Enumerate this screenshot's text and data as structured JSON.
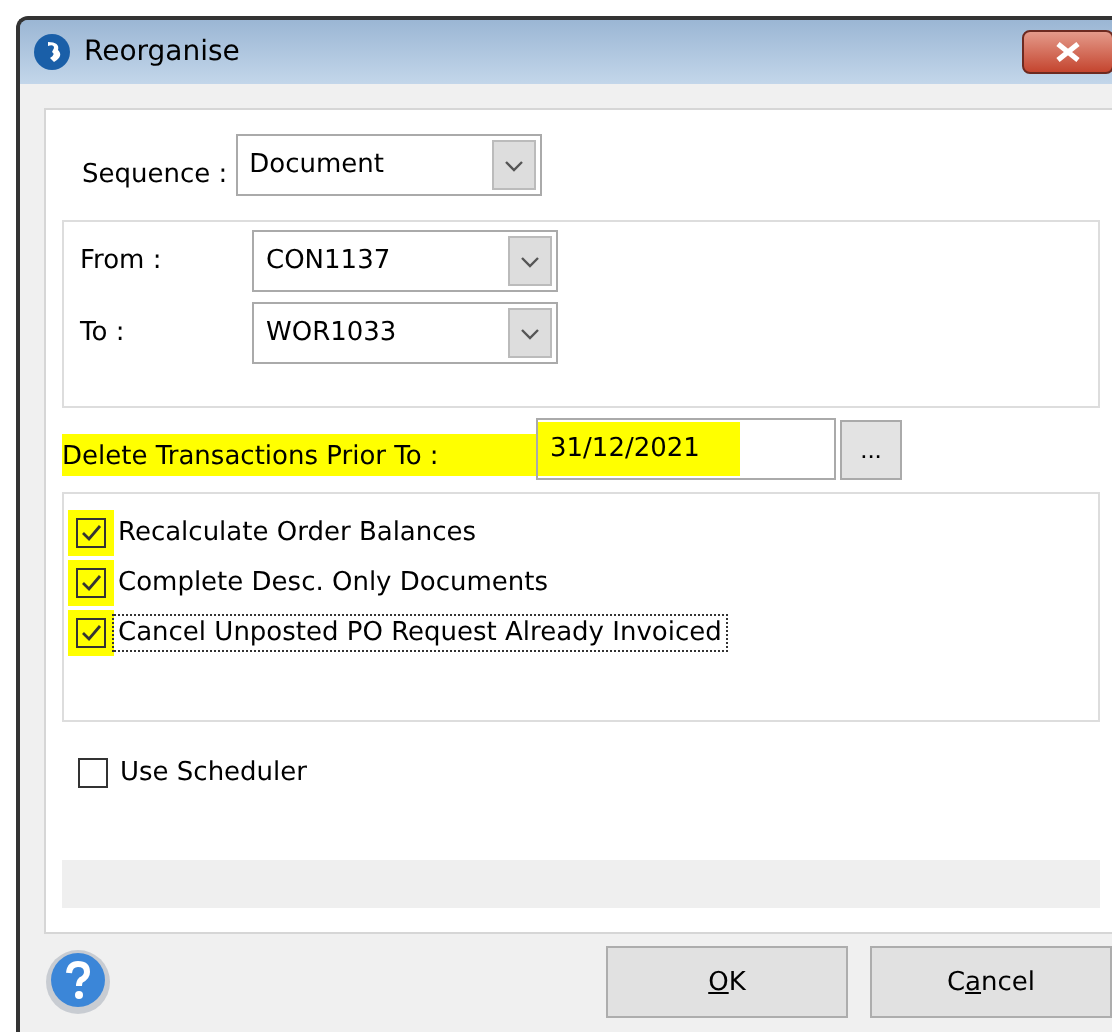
{
  "window": {
    "title": "Reorganise"
  },
  "sequence": {
    "label": "Sequence :",
    "value": "Document"
  },
  "range": [
    {
      "label": "From :",
      "value": "CON1137"
    },
    {
      "label": "To :",
      "value": "WOR1033"
    }
  ],
  "delete_prior": {
    "label": "Delete Transactions Prior To :",
    "value": "31/12/2021",
    "button": "...",
    "highlighted": true
  },
  "options": [
    {
      "label": "Recalculate Order Balances",
      "checked": true,
      "highlighted": true,
      "focused": false
    },
    {
      "label": "Complete Desc. Only Documents",
      "checked": true,
      "highlighted": true,
      "focused": false
    },
    {
      "label": "Cancel Unposted PO Request Already Invoiced",
      "checked": true,
      "highlighted": true,
      "focused": true
    }
  ],
  "use_scheduler": {
    "label": "Use Scheduler",
    "checked": false
  },
  "buttons": [
    {
      "key": "O",
      "rest": "K"
    },
    {
      "lead": "C",
      "key": "a",
      "rest": "ncel"
    }
  ]
}
